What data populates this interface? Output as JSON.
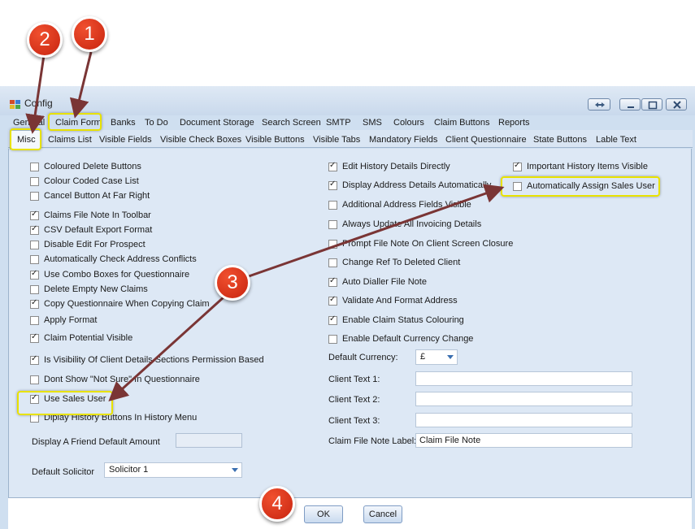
{
  "window": {
    "title": "Config",
    "icon": "config-app-icon"
  },
  "tabs_row1": [
    "General",
    "Claim Form",
    "Banks",
    "To Do",
    "Document Storage",
    "Search Screen",
    "SMTP",
    "SMS",
    "Colours",
    "Claim Buttons",
    "Reports"
  ],
  "tabs_row2": [
    "Misc",
    "Claims List",
    "Visible Fields",
    "Visible Check Boxes",
    "Visible Buttons",
    "Visible Tabs",
    "Mandatory Fields",
    "Client Questionnaire",
    "State Buttons",
    "Lable Text"
  ],
  "left_options": [
    {
      "label": "Coloured Delete Buttons",
      "checked": false
    },
    {
      "label": "Colour Coded Case List",
      "checked": false
    },
    {
      "label": "Cancel Button At Far Right",
      "checked": false
    },
    {
      "label": "Claims File Note In Toolbar",
      "checked": true
    },
    {
      "label": "CSV Default Export Format",
      "checked": true
    },
    {
      "label": "Disable Edit For Prospect",
      "checked": false
    },
    {
      "label": "Automatically Check Address Conflicts",
      "checked": false
    },
    {
      "label": "Use Combo Boxes for Questionnaire",
      "checked": true
    },
    {
      "label": "Delete Empty New Claims",
      "checked": false
    },
    {
      "label": "Copy Questionnaire When Copying Claim",
      "checked": true
    },
    {
      "label": "Apply Format",
      "checked": false
    },
    {
      "label": "Claim Potential Visible",
      "checked": true
    },
    {
      "label": "Is Visibility Of Client Details Sections Permission Based",
      "checked": true
    },
    {
      "label": "Dont Show \"Not Sure\" In Questionnaire",
      "checked": false
    },
    {
      "label": "Use Sales User",
      "checked": true
    },
    {
      "label": "Diplay History Buttons In History Menu",
      "checked": false
    }
  ],
  "mid_options": [
    {
      "label": "Edit History Details Directly",
      "checked": true
    },
    {
      "label": "Display Address Details Automatically",
      "checked": true
    },
    {
      "label": "Additional Address Fields Visible",
      "checked": false
    },
    {
      "label": "Always Update All Invoicing Details",
      "checked": false
    },
    {
      "label": "Prompt File Note On Client Screen Closure",
      "checked": false
    },
    {
      "label": "Change Ref To Deleted Client",
      "checked": false
    },
    {
      "label": "Auto Dialler File Note",
      "checked": true
    },
    {
      "label": "Validate And Format Address",
      "checked": true
    },
    {
      "label": "Enable Claim Status Colouring",
      "checked": true
    },
    {
      "label": "Enable Default Currency Change",
      "checked": false
    }
  ],
  "right_options": [
    {
      "label": "Important History Items Visible",
      "checked": true
    },
    {
      "label": "Automatically Assign Sales User",
      "checked": false
    }
  ],
  "fields": {
    "friend_amount_label": "Display A Friend Default Amount",
    "friend_amount_value": "",
    "default_solicitor_label": "Default Solicitor",
    "default_solicitor_value": "Solicitor 1",
    "default_currency_label": "Default Currency:",
    "default_currency_value": "£",
    "client_text1_label": "Client Text 1:",
    "client_text1_value": "",
    "client_text2_label": "Client Text 2:",
    "client_text2_value": "",
    "client_text3_label": "Client Text 3:",
    "client_text3_value": "",
    "claim_note_label": "Claim File Note Label:",
    "claim_note_value": "Claim File Note"
  },
  "buttons": {
    "ok": "OK",
    "cancel": "Cancel"
  },
  "markers": [
    "1",
    "2",
    "3",
    "4"
  ],
  "colors": {
    "marker": "#d2321a",
    "highlight": "#e8e200",
    "arrow": "#7a3535"
  }
}
